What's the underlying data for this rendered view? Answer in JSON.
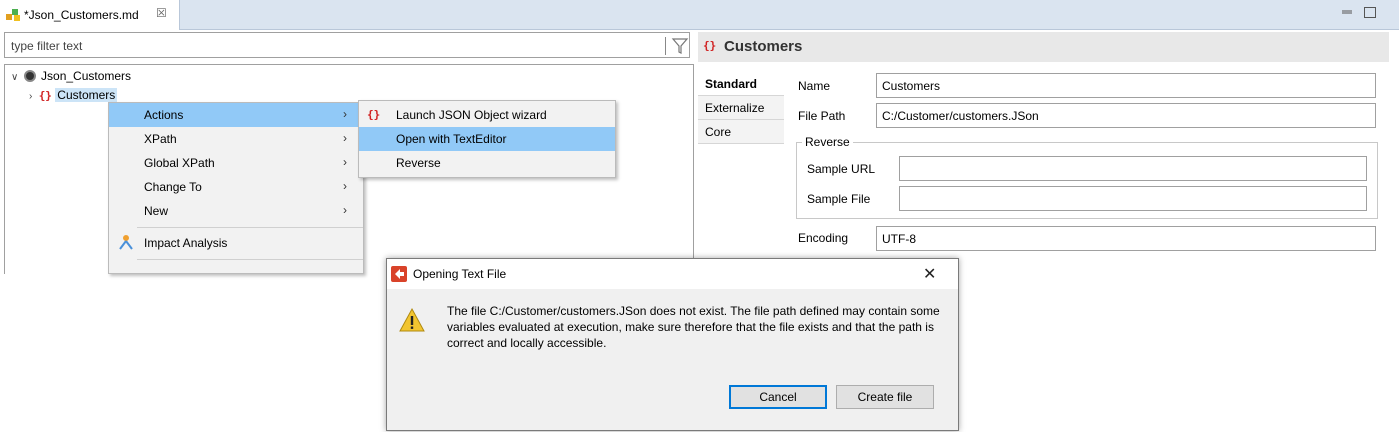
{
  "editor_tab": {
    "title": "*Json_Customers.md",
    "close_glyph": "☒"
  },
  "filter": {
    "placeholder": "type filter text"
  },
  "tree": {
    "root": {
      "label": "Json_Customers",
      "twisty": "∨"
    },
    "child": {
      "label": "Customers",
      "brace": "{}",
      "twisty": "›"
    }
  },
  "context_menu": {
    "items": [
      {
        "label": "Actions",
        "has_submenu": true,
        "highlighted": true
      },
      {
        "label": "XPath",
        "has_submenu": true
      },
      {
        "label": "Global XPath",
        "has_submenu": true
      },
      {
        "label": "Change To",
        "has_submenu": true
      },
      {
        "label": "New",
        "has_submenu": true
      },
      {
        "label": "Impact Analysis",
        "icon": "impact-analysis-icon"
      }
    ],
    "arrow": "›"
  },
  "submenu": {
    "items": [
      {
        "label": "Launch JSON Object wizard",
        "icon": "json-object-icon",
        "brace": "{}"
      },
      {
        "label": "Open with TextEditor",
        "highlighted": true
      },
      {
        "label": "Reverse"
      }
    ]
  },
  "right_panel": {
    "title": "Customers",
    "brace": "{}",
    "side_tabs": [
      "Standard",
      "Externalize",
      "Core"
    ],
    "fields": {
      "name_label": "Name",
      "name_value": "Customers",
      "filepath_label": "File Path",
      "filepath_value": "C:/Customer/customers.JSon",
      "reverse_group": "Reverse",
      "sample_url_label": "Sample URL",
      "sample_url_value": "",
      "sample_file_label": "Sample File",
      "sample_file_value": "",
      "encoding_label": "Encoding",
      "encoding_value": "UTF-8"
    }
  },
  "dialog": {
    "title": "Opening Text File",
    "close_glyph": "✕",
    "message": "The file C:/Customer/customers.JSon does not exist. The file path defined may contain some variables evaluated at execution, make sure therefore that the file exists and that the path is correct and locally accessible.",
    "buttons": {
      "cancel": "Cancel",
      "create": "Create file"
    }
  },
  "colors": {
    "menu_highlight": "#91c9f7",
    "brace_red": "#d02020",
    "dialog_icon": "#d9432a",
    "warning": "#f2c530"
  }
}
